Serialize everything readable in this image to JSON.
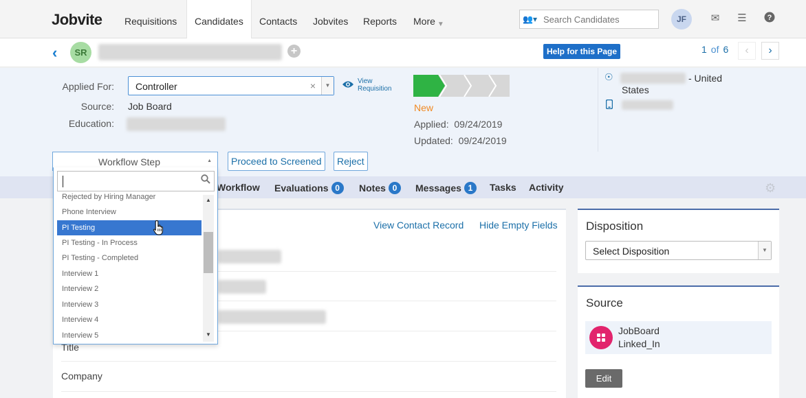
{
  "app": {
    "logo": "Jobvite"
  },
  "nav": {
    "items": [
      "Requisitions",
      "Candidates",
      "Contacts",
      "Jobvites",
      "Reports",
      "More"
    ],
    "active": "Candidates",
    "search_placeholder": "Search Candidates",
    "user_initials": "JF"
  },
  "candidate": {
    "initials": "SR",
    "help_label": "Help for this Page",
    "pager": {
      "current": "1",
      "of": "of",
      "total": "6"
    }
  },
  "details": {
    "applied_for_label": "Applied For:",
    "applied_for_value": "Controller",
    "view_requisition": [
      "View",
      "Requisition"
    ],
    "source_label": "Source:",
    "source_value": "Job Board",
    "education_label": "Education:",
    "status": "New",
    "applied_label": "Applied:",
    "applied_date": "09/24/2019",
    "updated_label": "Updated:",
    "updated_date": "09/24/2019",
    "location_suffix": "- United",
    "location_line2": "States",
    "pipeline_colors": {
      "active": "#2fb344",
      "inactive": "#d7d7d7"
    }
  },
  "workflow": {
    "step_label": "Workflow Step",
    "proceed_label": "Proceed to Screened",
    "reject_label": "Reject",
    "search_value": "",
    "options": [
      "Rejected by Hiring Manager",
      "Phone Interview",
      "PI Testing",
      "PI Testing - In Process",
      "PI Testing - Completed",
      "Interview 1",
      "Interview 2",
      "Interview 3",
      "Interview 4",
      "Interview 5"
    ],
    "highlighted": "PI Testing"
  },
  "tabs": {
    "workflow": "Workflow",
    "evaluations": "Evaluations",
    "evaluations_count": "0",
    "notes": "Notes",
    "notes_count": "0",
    "messages": "Messages",
    "messages_count": "1",
    "tasks": "Tasks",
    "activity": "Activity"
  },
  "main": {
    "view_contact_record": "View Contact Record",
    "hide_empty_fields": "Hide Empty Fields",
    "title_label": "Title",
    "company_label": "Company"
  },
  "disposition": {
    "title": "Disposition",
    "select_label": "Select Disposition"
  },
  "source": {
    "title": "Source",
    "line1": "JobBoard",
    "line2": "Linked_In",
    "edit_label": "Edit",
    "icon_color": "#e2246d"
  }
}
